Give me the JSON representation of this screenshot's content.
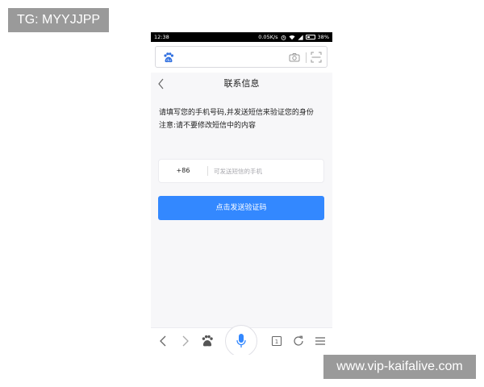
{
  "watermarks": {
    "top_left": "TG: MYYJJPP",
    "bottom_right": "www.vip-kaifalive.com"
  },
  "status_bar": {
    "time": "12:38",
    "speed": "0.05K/s",
    "battery": "38%",
    "battery_level": 0.38,
    "icons": [
      "alarm-icon",
      "wifi-icon",
      "signal-icon",
      "battery-icon"
    ]
  },
  "search_bar": {
    "logo_icon": "baidu-paw-icon",
    "icons": [
      "camera-icon",
      "scan-icon"
    ]
  },
  "page": {
    "title": "联系信息",
    "back_icon": "chevron-left-icon",
    "description_line1": "请填写您的手机号码,并发送短信来验证您的身份",
    "description_line2": "注意:请不要修改短信中的内容"
  },
  "phone_field": {
    "country_code": "+86",
    "value": "",
    "placeholder": "可发送短信的手机"
  },
  "send_button": {
    "label": "点击发送验证码"
  },
  "toolbar": {
    "icons": [
      "chevron-left-icon",
      "chevron-right-icon",
      "baidu-paw-icon",
      "microphone-icon",
      "tabs-icon",
      "refresh-icon",
      "menu-icon"
    ],
    "tab_count": "1"
  },
  "colors": {
    "accent": "#3388ff",
    "watermark_bg": "#9a9a9a",
    "page_bg": "#f7f7f9",
    "status_bar_bg": "#000000"
  }
}
